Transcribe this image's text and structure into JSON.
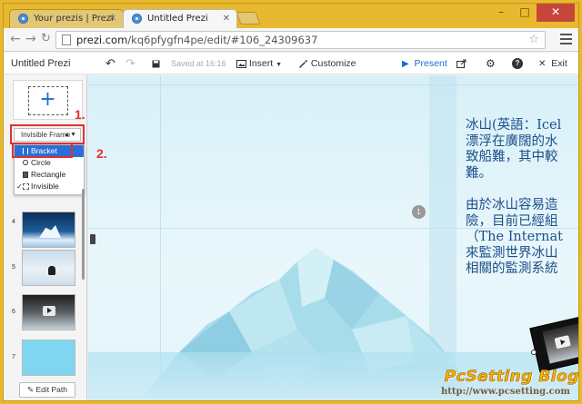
{
  "browser": {
    "tabs": [
      {
        "title": "Your prezis | Prezi",
        "active": false
      },
      {
        "title": "Untitled Prezi",
        "active": true
      }
    ],
    "url_host": "prezi.com",
    "url_path": "/kq6pfygfn4pe/edit/#106_24309637",
    "window_controls": [
      "–",
      "□",
      "✕"
    ]
  },
  "prezi_toolbar": {
    "title": "Untitled Prezi",
    "saved": "Saved at 16:16",
    "insert": "Insert",
    "customize": "Customize",
    "present": "Present",
    "exit": "Exit",
    "accent_color": "#1a6fd0"
  },
  "left_panel": {
    "add_symbol": "+",
    "frame_select": "Invisible Frame",
    "frame_options": [
      {
        "label": "Bracket",
        "icon": "bracket-icon",
        "selected": true,
        "checked": false
      },
      {
        "label": "Circle",
        "icon": "circle-icon",
        "selected": false,
        "checked": false
      },
      {
        "label": "Rectangle",
        "icon": "rectangle-icon",
        "selected": false,
        "checked": false
      },
      {
        "label": "Invisible",
        "icon": "dashed-frame-icon",
        "selected": false,
        "checked": true
      }
    ],
    "check_mark": "✓",
    "thumbnails": [
      {
        "num": "4",
        "content": "iceberg night"
      },
      {
        "num": "5",
        "content": "penguin on ice"
      },
      {
        "num": "6",
        "content": "video"
      },
      {
        "num": "7",
        "content": "blank cyan"
      }
    ],
    "edit_path": "Edit Path"
  },
  "annotations": {
    "step1": "1.",
    "step2": "2.",
    "color": "#e03030"
  },
  "canvas": {
    "path_number": "1",
    "paragraph1": [
      "冰山(英語：Icel",
      "漂浮在廣闊的水",
      "致船難，其中較",
      "難。"
    ],
    "paragraph2": [
      "由於冰山容易造",
      "險，目前已經組",
      "（The Internat",
      "來監測世界冰山",
      "相關的監測系統"
    ]
  },
  "watermark": {
    "title": "PcSetting Blog",
    "url": "http://www.pcsetting.com"
  }
}
